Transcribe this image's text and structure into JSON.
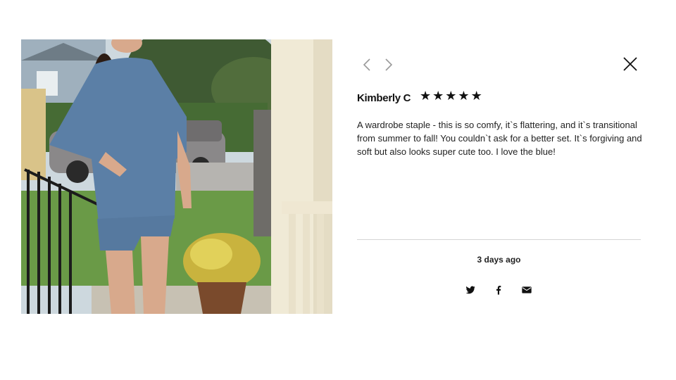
{
  "review": {
    "reviewer_name": "Kimberly C",
    "rating": 5,
    "star_glyph": "★",
    "text": "A wardrobe staple - this is so comfy, it`s flattering, and it`s transitional from summer to fall! You couldn`t ask for a better set. It`s forgiving and soft but also looks super cute too. I love the blue!",
    "posted": "3 days ago"
  },
  "photo": {
    "alt": "customer-photo"
  },
  "nav": {
    "prev_icon": "chevron-left-icon",
    "next_icon": "chevron-right-icon",
    "close_icon": "close-icon"
  },
  "share": {
    "icons": [
      "twitter-icon",
      "facebook-icon",
      "email-icon"
    ]
  },
  "colors": {
    "text": "#111111",
    "divider": "#d4d4d4",
    "outfit": "#5b7fa6"
  }
}
